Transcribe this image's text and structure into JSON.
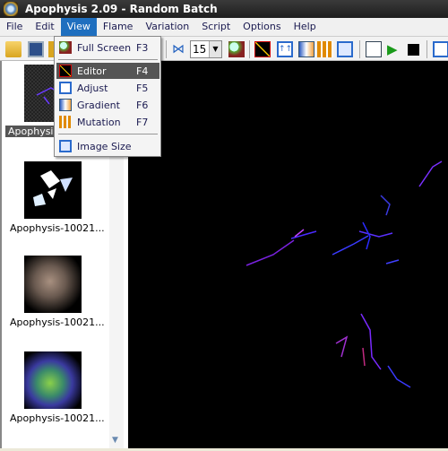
{
  "window": {
    "title": "Apophysis 2.09 - Random Batch"
  },
  "menubar": [
    "File",
    "Edit",
    "View",
    "Flame",
    "Variation",
    "Script",
    "Options",
    "Help"
  ],
  "active_menu": "View",
  "view_menu": [
    {
      "label": "Full Screen",
      "shortcut": "F3",
      "icon": "fullscreen-icon"
    },
    {
      "label": "Editor",
      "shortcut": "F4",
      "icon": "editor-icon",
      "highlighted": true
    },
    {
      "label": "Adjust",
      "shortcut": "F5",
      "icon": "adjust-icon"
    },
    {
      "label": "Gradient",
      "shortcut": "F6",
      "icon": "gradient-icon"
    },
    {
      "label": "Mutation",
      "shortcut": "F7",
      "icon": "mutation-icon"
    },
    {
      "label": "Image Size",
      "shortcut": "",
      "icon": "image-size-icon"
    }
  ],
  "toolbar": {
    "depth_value": "15"
  },
  "thumbnails": [
    {
      "label": "Apophysis-",
      "selected": true
    },
    {
      "label": "Apophysis-10021..."
    },
    {
      "label": "Apophysis-10021..."
    },
    {
      "label": "Apophysis-10021..."
    }
  ],
  "colors": {
    "highlight": "#555555",
    "menu_active": "#1f6fbf",
    "canvas": "#000000"
  }
}
